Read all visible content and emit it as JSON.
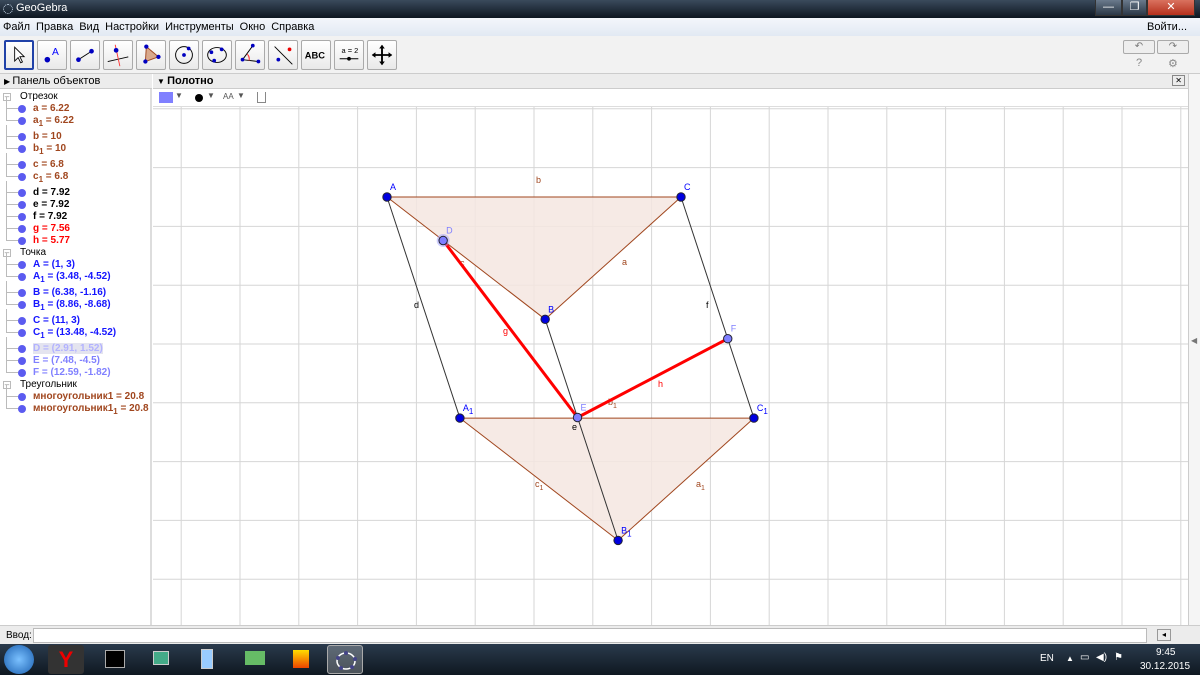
{
  "window": {
    "title": "GeoGebra",
    "minimize": "—",
    "maximize": "❐",
    "close": "✕"
  },
  "menu": {
    "items": [
      "Файл",
      "Правка",
      "Вид",
      "Настройки",
      "Инструменты",
      "Окно",
      "Справка"
    ],
    "login": "Войти..."
  },
  "toolbar": {
    "tools": [
      "move",
      "point",
      "segment",
      "perpendicular-line",
      "polygon",
      "circle-center-point",
      "circle-three-points",
      "angle",
      "reflect-about-line",
      "text",
      "slider",
      "move-graphics-view"
    ],
    "text_tool_label": "ABC",
    "slider_label": "a = 2",
    "undo": "↶",
    "redo": "↷",
    "help": "?",
    "settings": "⚙"
  },
  "algebra": {
    "title": "Панель объектов",
    "close": "✕",
    "groups": [
      {
        "label": "Отрезок",
        "items": [
          {
            "name": "a",
            "sub": "",
            "value": " = 6.22",
            "color": "#a0461e"
          },
          {
            "name": "a",
            "sub": "1",
            "value": " = 6.22",
            "color": "#a0461e"
          },
          {
            "name": "b",
            "sub": "",
            "value": " = 10",
            "color": "#a0461e"
          },
          {
            "name": "b",
            "sub": "1",
            "value": " = 10",
            "color": "#a0461e"
          },
          {
            "name": "c",
            "sub": "",
            "value": " = 6.8",
            "color": "#a0461e"
          },
          {
            "name": "c",
            "sub": "1",
            "value": " = 6.8",
            "color": "#a0461e"
          },
          {
            "name": "d",
            "sub": "",
            "value": " = 7.92",
            "color": "#000000"
          },
          {
            "name": "e",
            "sub": "",
            "value": " = 7.92",
            "color": "#000000"
          },
          {
            "name": "f",
            "sub": "",
            "value": " = 7.92",
            "color": "#000000"
          },
          {
            "name": "g",
            "sub": "",
            "value": " = 7.56",
            "color": "#ff0000"
          },
          {
            "name": "h",
            "sub": "",
            "value": " = 5.77",
            "color": "#ff0000"
          }
        ]
      },
      {
        "label": "Точка",
        "items": [
          {
            "name": "A",
            "sub": "",
            "value": " = (1, 3)",
            "color": "#1515ff"
          },
          {
            "name": "A",
            "sub": "1",
            "value": " = (3.48, -4.52)",
            "color": "#1515ff"
          },
          {
            "name": "B",
            "sub": "",
            "value": " = (6.38, -1.16)",
            "color": "#1515ff"
          },
          {
            "name": "B",
            "sub": "1",
            "value": " = (8.86, -8.68)",
            "color": "#1515ff"
          },
          {
            "name": "C",
            "sub": "",
            "value": " = (11, 3)",
            "color": "#1515ff"
          },
          {
            "name": "C",
            "sub": "1",
            "value": " = (13.48, -4.52)",
            "color": "#1515ff"
          },
          {
            "name": "D",
            "sub": "",
            "value": " = (2.91, 1.52)",
            "color": "#8080ff",
            "selected": true
          },
          {
            "name": "E",
            "sub": "",
            "value": " = (7.48, -4.5)",
            "color": "#8080ff"
          },
          {
            "name": "F",
            "sub": "",
            "value": " = (12.59, -1.82)",
            "color": "#8080ff"
          }
        ]
      },
      {
        "label": "Треугольник",
        "items": [
          {
            "name": "многоугольник1",
            "sub": "",
            "value": " = 20.8",
            "color": "#a0461e"
          },
          {
            "name": "многоугольник1",
            "sub": "1",
            "value": " = 20.8",
            "color": "#a0461e"
          }
        ]
      }
    ]
  },
  "graphics": {
    "title": "Полотно",
    "font_size_icon": "AA",
    "colors": {
      "poly": "#a0461e",
      "fill": "#f5e6e0",
      "point": "#0000e0",
      "light_point": "#7f7fff",
      "red": "#ff0000",
      "grid": "#d6d6d6"
    },
    "points": [
      {
        "id": "A",
        "label": "A",
        "sub": "",
        "x": 1,
        "y": 3,
        "light": false
      },
      {
        "id": "B",
        "label": "B",
        "sub": "",
        "x": 6.38,
        "y": -1.16,
        "light": false
      },
      {
        "id": "C",
        "label": "C",
        "sub": "",
        "x": 11,
        "y": 3,
        "light": false
      },
      {
        "id": "A1",
        "label": "A",
        "sub": "1",
        "x": 3.48,
        "y": -4.52,
        "light": false
      },
      {
        "id": "B1",
        "label": "B",
        "sub": "1",
        "x": 8.86,
        "y": -8.68,
        "light": false
      },
      {
        "id": "C1",
        "label": "C",
        "sub": "1",
        "x": 13.48,
        "y": -4.52,
        "light": false
      },
      {
        "id": "D",
        "label": "D",
        "sub": "",
        "x": 2.91,
        "y": 1.52,
        "light": true
      },
      {
        "id": "E",
        "label": "E",
        "sub": "",
        "x": 7.48,
        "y": -4.5,
        "light": true
      },
      {
        "id": "F",
        "label": "F",
        "sub": "",
        "x": 12.59,
        "y": -1.82,
        "light": true
      }
    ],
    "polygons": [
      [
        "A",
        "B",
        "C"
      ],
      [
        "A1",
        "B1",
        "C1"
      ]
    ],
    "segments": [
      {
        "id": "a",
        "label": "a",
        "sub": "",
        "from": "B",
        "to": "C",
        "kind": "poly"
      },
      {
        "id": "b",
        "label": "b",
        "sub": "",
        "from": "A",
        "to": "C",
        "kind": "poly"
      },
      {
        "id": "c",
        "label": "c",
        "sub": "",
        "from": "A",
        "to": "B",
        "kind": "poly"
      },
      {
        "id": "a1",
        "label": "a",
        "sub": "1",
        "from": "B1",
        "to": "C1",
        "kind": "poly"
      },
      {
        "id": "b1",
        "label": "b",
        "sub": "1",
        "from": "A1",
        "to": "C1",
        "kind": "poly"
      },
      {
        "id": "c1",
        "label": "c",
        "sub": "1",
        "from": "A1",
        "to": "B1",
        "kind": "poly"
      },
      {
        "id": "d",
        "label": "d",
        "sub": "",
        "from": "A",
        "to": "A1",
        "kind": "black"
      },
      {
        "id": "e",
        "label": "e",
        "sub": "",
        "from": "B",
        "to": "B1",
        "kind": "black"
      },
      {
        "id": "f",
        "label": "f",
        "sub": "",
        "from": "C",
        "to": "C1",
        "kind": "black"
      },
      {
        "id": "g",
        "label": "g",
        "sub": "",
        "from": "D",
        "to": "E",
        "kind": "red"
      },
      {
        "id": "h",
        "label": "h",
        "sub": "",
        "from": "E",
        "to": "F",
        "kind": "red"
      }
    ]
  },
  "input": {
    "label": "Ввод:",
    "value": ""
  },
  "taskbar": {
    "lang": "EN",
    "time": "9:45",
    "date": "30.12.2015"
  }
}
